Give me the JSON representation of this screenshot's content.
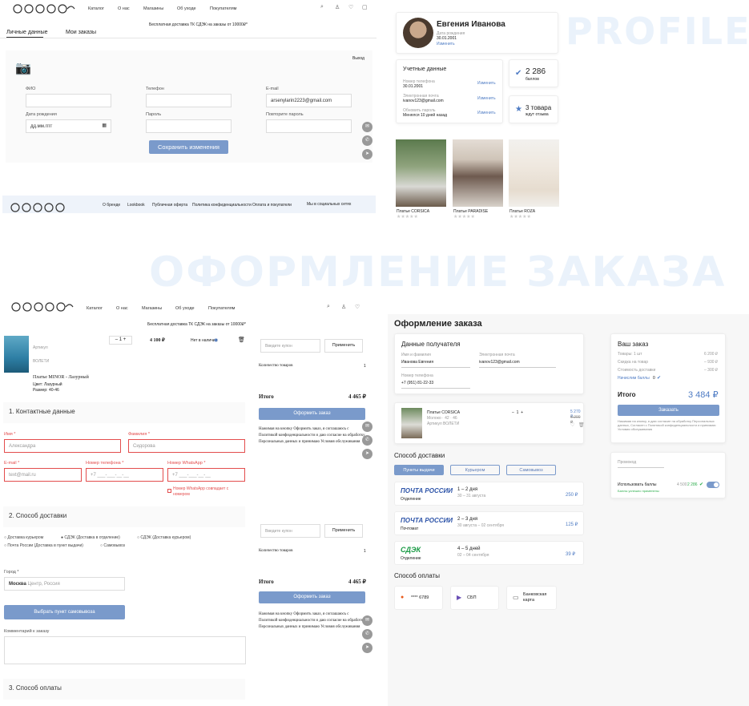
{
  "watermarks": {
    "profile": "PROFILE",
    "order": "ОФОРМЛЕНИЕ ЗАКАЗА"
  },
  "nav": {
    "catalog": "Каталог",
    "about": "О нас",
    "shops": "Магазины",
    "care": "Об уходе",
    "buyers": "Покупателям"
  },
  "banner": "Бесплатная доставка ТК СДЭК на заказы от 10000₽*",
  "account": {
    "tabs": [
      "Личные данные",
      "Мои заказы"
    ],
    "logout": "Выход",
    "fields": {
      "fio": "ФИО",
      "phone": "Телефон",
      "email": "E-mail",
      "email_value": "arsenylarin2223@gmail.com",
      "birth": "Дата рождения",
      "birth_value": "дд.мм.гггг",
      "password": "Пароль",
      "repeat": "Повторите пароль"
    },
    "save": "Сохранить изменения",
    "footer": [
      "О бренде",
      "Lookbook",
      "Публичная оферта",
      "Политика конфиденциальности",
      "Оплата и покупатели"
    ],
    "social": "Мы в социальных сетях"
  },
  "profile": {
    "name": "Евгения Иванова",
    "dob_label": "Дата рождения",
    "dob": "30.01.2001",
    "edit": "Изменить",
    "creds_title": "Учетные данные",
    "phone_label": "Номер телефона",
    "phone": "30.01.2001",
    "email_label": "Электронная почта",
    "email": "ivanov123@gmail.com",
    "pass_label": "Обновить пароль",
    "pass": "Менялся 10 дней назад",
    "change": "Изменить",
    "points": "2 286",
    "points_label": "баллов",
    "goods": "3 товара",
    "goods_label": "ждут отзыва",
    "items": [
      "Платье CORSICA",
      "Платье PARADISE",
      "Платье ROZA"
    ]
  },
  "cart": {
    "item_label": "Артикул",
    "color_label": "ВОЛЕТИ",
    "qty": "1",
    "price": "4 100 ₽",
    "fav": "Нет в наличии",
    "name": "Платье MINOR - Лазурный",
    "color": "Цвет: Лазурный",
    "size": "Размер: 40-46"
  },
  "checkout": {
    "sec1": "1. Контактные данные",
    "sec2": "2. Способ доставки",
    "sec3": "3. Способ оплаты",
    "first": "Имя *",
    "first_ph": "Александра",
    "last": "Фамилия *",
    "last_ph": "Сидорова",
    "email": "E-mail *",
    "email_ph": "text@mail.ru",
    "phone": "Номер телефона *",
    "phone_ph": "+7 ___-___-__-__",
    "wa": "Номер WhatsApp *",
    "wa_ph": "+7 ___-___-__-__",
    "wa_same": "Номер WhatsApp совпадает с номером",
    "opts": [
      "Доставка курьером",
      "СДЭК (Доставка в отделение)",
      "СДЭК (Доставка курьером)",
      "Почта России (Доставка в пункт выдачи)",
      "Самовывоз"
    ],
    "city": "Город *",
    "city_val": "Москва",
    "city_ph": "Центр, Россия",
    "pickup": "Выбрать пункт самовывоза",
    "comment": "Комментарий к заказу"
  },
  "summary": {
    "coupon": "Введите купон",
    "apply": "Применить",
    "count": "Количество товаров",
    "count_val": "1",
    "total": "Итого",
    "total_val": "4 465 ₽",
    "order": "Оформить заказ",
    "agree": "Нажимая на кнопку Оформить заказ, я соглашаюсь с Политикой конфиденциальности и даю согласие на обработку Персональных данных и принимаю Условия обслуживания"
  },
  "order2": {
    "title": "Оформление заказа",
    "recipient": "Данные получателя",
    "name_label": "Имя и фамилия",
    "name": "Иванова Евгения",
    "email_label": "Электронная почта",
    "email": "ivanov123@gmail.com",
    "phone_label": "Номер телефона",
    "phone": "+7 (951) 81-22-33",
    "item": "Платье CORSICA",
    "item_meta": "Молоко · 42 · 46",
    "item_art": "Артикул ВОЛЕТИ",
    "item_price": "5 270 ₽",
    "item_old": "6 200 ₽",
    "qty": "1",
    "delivery": "Способ доставки",
    "tabs": [
      "Пункты выдачи",
      "Курьером",
      "Самовывоз"
    ],
    "ships": [
      {
        "logo": "ПОЧТА РОССИИ",
        "type": "Отделение",
        "days": "1 – 2 дня",
        "date": "30 – 31 августа",
        "price": "250 ₽"
      },
      {
        "logo": "ПОЧТА РОССИИ",
        "type": "Почтомат",
        "days": "2 – 3 дня",
        "date": "30 августа – 02 сентября",
        "price": "125 ₽"
      },
      {
        "logo": "СДЭК",
        "type": "Отделение",
        "days": "4 – 5 дней",
        "date": "02 – 04 сентября",
        "price": "39 ₽"
      }
    ],
    "payment": "Способ оплаты",
    "pays": [
      "**** 6789",
      "СБП",
      "Банковская карта"
    ],
    "your": "Ваш заказ",
    "rows": [
      [
        "Товары: 1 шт",
        "6 200 ₽"
      ],
      [
        "Скидка на товар",
        "– 930 ₽"
      ],
      [
        "Стоимость доставки",
        "– 300 ₽"
      ]
    ],
    "bonus": "Начислим баллы",
    "bonus_val": "0",
    "total": "Итого",
    "total_val": "3 484 ₽",
    "order": "Заказать",
    "fine": "Нажимая на кнопку, я даю согласие на обработку Персональных данных, Согласен с Политикой конфиденциальности и принимаю Условия обслуживания",
    "promo": "Промокод",
    "use_points": "Использовать баллы",
    "points_old": "4 500",
    "points": "2 286",
    "points_note": "Баллы успешно применены"
  },
  "colors": {
    "accent": "#7a9acb",
    "link": "#4f7cc4",
    "error": "#e34d4d",
    "green": "#2fae4e"
  }
}
